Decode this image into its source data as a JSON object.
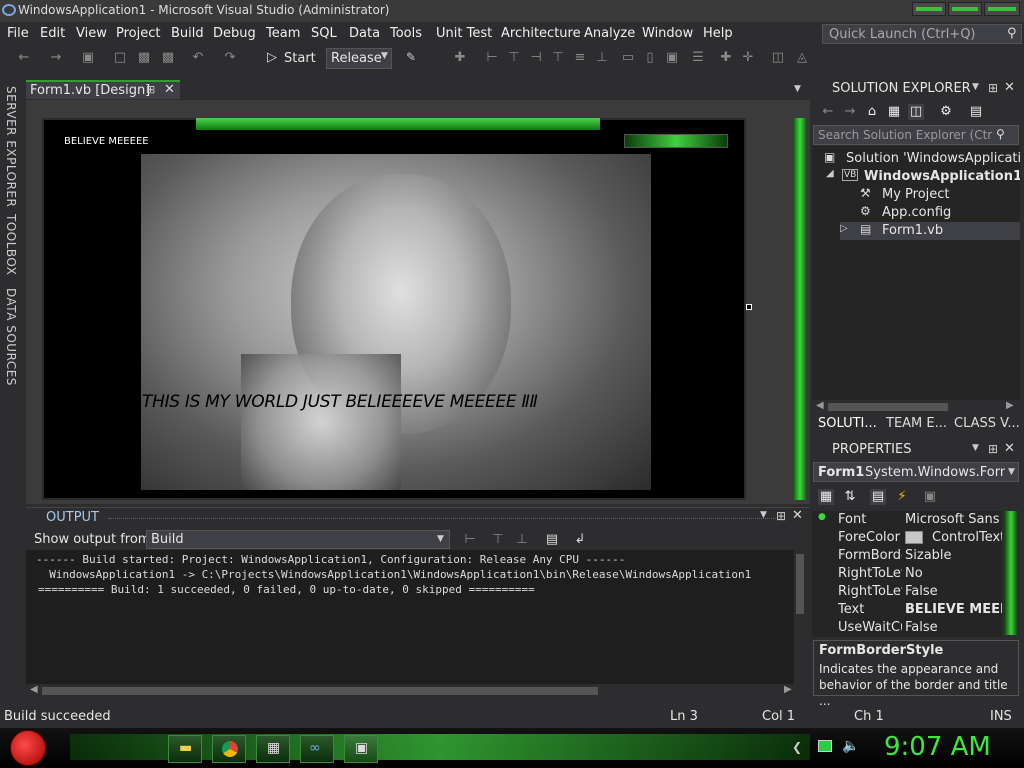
{
  "window": {
    "title": "WindowsApplication1 - Microsoft Visual Studio (Administrator)"
  },
  "menu": [
    "File",
    "Edit",
    "View",
    "Project",
    "Build",
    "Debug",
    "Team",
    "SQL",
    "Data",
    "Tools",
    "Unit Test",
    "Architecture",
    "Analyze",
    "Window",
    "Help"
  ],
  "quick_launch": {
    "placeholder": "Quick Launch (Ctrl+Q)"
  },
  "toolbar": {
    "start_label": "Start",
    "configuration": "Release"
  },
  "side_tabs": [
    "SERVER EXPLORER",
    "TOOLBOX",
    "DATA SOURCES"
  ],
  "document_tab": {
    "label": "Form1.vb [Design]"
  },
  "form": {
    "title": "BELIEVE MEEEEE",
    "label_text": "THIS IS MY WORLD JUST BELIEEEEVE MEEEEE ⅡⅡ"
  },
  "output": {
    "title": "OUTPUT",
    "show_from_label": "Show output from:",
    "source": "Build",
    "lines": [
      "------ Build started: Project: WindowsApplication1, Configuration: Release Any CPU ------",
      "  WindowsApplication1 -> C:\\Projects\\WindowsApplication1\\WindowsApplication1\\bin\\Release\\WindowsApplication1",
      "========== Build: 1 succeeded, 0 failed, 0 up-to-date, 0 skipped =========="
    ]
  },
  "solution_explorer": {
    "title": "SOLUTION EXPLORER",
    "search_placeholder": "Search Solution Explorer (Ctr",
    "tree": [
      {
        "label": "Solution 'WindowsApplication",
        "icon": "solution-icon",
        "bold": false
      },
      {
        "label": "WindowsApplication1",
        "icon": "vb-project-icon",
        "bold": true
      },
      {
        "label": "My Project",
        "icon": "wrench-icon",
        "bold": false
      },
      {
        "label": "App.config",
        "icon": "config-icon",
        "bold": false
      },
      {
        "label": "Form1.vb",
        "icon": "form-icon",
        "bold": false
      }
    ],
    "tabs": [
      "SOLUTI...",
      "TEAM E...",
      "CLASS V..."
    ]
  },
  "properties": {
    "title": "PROPERTIES",
    "object_name": "Form1",
    "object_type": "System.Windows.Forms",
    "rows": [
      {
        "name": "Font",
        "value": "Microsoft Sans S"
      },
      {
        "name": "ForeColor",
        "value": "ControlText"
      },
      {
        "name": "FormBorde",
        "value": "Sizable"
      },
      {
        "name": "RightToLeft",
        "value": "No"
      },
      {
        "name": "RightToLeft",
        "value": "False"
      },
      {
        "name": "Text",
        "value": "BELIEVE MEEEE"
      },
      {
        "name": "UseWaitCu",
        "value": "False"
      }
    ],
    "desc_title": "FormBorderStyle",
    "desc_text": "Indicates the appearance and behavior of the border and title ..."
  },
  "status": {
    "message": "Build succeeded",
    "ln": "Ln 3",
    "col": "Col 1",
    "ch": "Ch 1",
    "mode": "INS"
  },
  "taskbar": {
    "clock": "9:07 AM"
  },
  "colors": {
    "accent": "#3ed83e",
    "bg": "#2d2d30",
    "panel": "#252526"
  }
}
